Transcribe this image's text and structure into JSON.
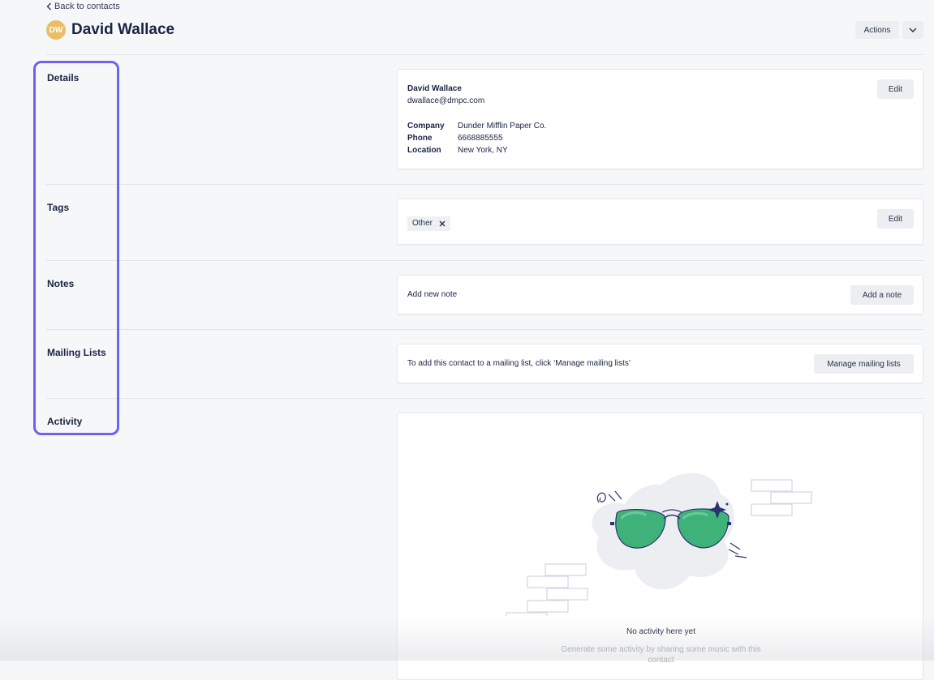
{
  "header": {
    "back_label": "Back to contacts",
    "avatar_initials": "DW",
    "contact_name": "David Wallace",
    "actions_label": "Actions"
  },
  "sections": {
    "details": "Details",
    "tags": "Tags",
    "notes": "Notes",
    "mailing_lists": "Mailing Lists",
    "activity": "Activity"
  },
  "details_card": {
    "name": "David Wallace",
    "email": "dwallace@dmpc.com",
    "fields": [
      {
        "key": "Company",
        "value": "Dunder Mifflin Paper Co."
      },
      {
        "key": "Phone",
        "value": "6668885555"
      },
      {
        "key": "Location",
        "value": "New York, NY"
      }
    ],
    "edit_label": "Edit"
  },
  "tags_card": {
    "tags": [
      "Other"
    ],
    "edit_label": "Edit"
  },
  "notes_card": {
    "prompt": "Add new note",
    "button_label": "Add a note"
  },
  "mailing_card": {
    "prompt": "To add this contact to a mailing list, click ‘Manage mailing lists’",
    "button_label": "Manage mailing lists"
  },
  "activity_card": {
    "empty_title": "No activity here yet",
    "empty_subtitle": "Generate some activity by sharing some music with this contact"
  },
  "colors": {
    "accent_highlight": "#6b63f2",
    "avatar": "#e8bf66",
    "sunglasses_lens": "#3fb27a"
  }
}
